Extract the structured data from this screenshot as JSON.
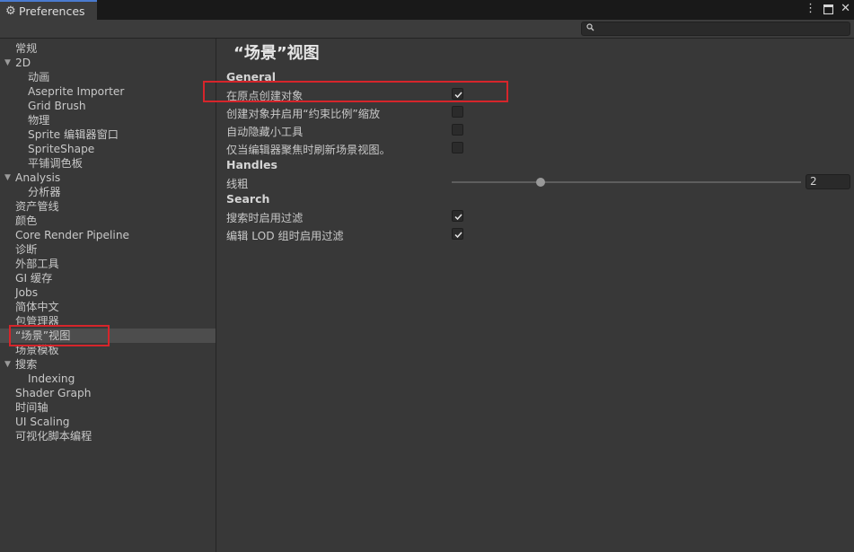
{
  "window": {
    "tab_title": "Preferences",
    "tab_icon": "gear-icon",
    "controls": [
      "more-icon",
      "maximize-icon",
      "close-icon"
    ]
  },
  "search": {
    "value": "",
    "placeholder": ""
  },
  "sidebar": {
    "items": [
      {
        "label": "常规"
      },
      {
        "label": "2D"
      },
      {
        "label": "动画"
      },
      {
        "label": "Aseprite Importer"
      },
      {
        "label": "Grid Brush"
      },
      {
        "label": "物理"
      },
      {
        "label": "Sprite 编辑器窗口"
      },
      {
        "label": "SpriteShape"
      },
      {
        "label": "平铺调色板"
      },
      {
        "label": "Analysis"
      },
      {
        "label": "分析器"
      },
      {
        "label": "资产管线"
      },
      {
        "label": "颜色"
      },
      {
        "label": "Core Render Pipeline"
      },
      {
        "label": "诊断"
      },
      {
        "label": "外部工具"
      },
      {
        "label": "GI 缓存"
      },
      {
        "label": "Jobs"
      },
      {
        "label": "简体中文"
      },
      {
        "label": "包管理器"
      },
      {
        "label": "“场景”视图"
      },
      {
        "label": "场景模板"
      },
      {
        "label": "搜索"
      },
      {
        "label": "Indexing"
      },
      {
        "label": "Shader Graph"
      },
      {
        "label": "时间轴"
      },
      {
        "label": "UI Scaling"
      },
      {
        "label": "可视化脚本编程"
      }
    ],
    "selected": "“场景”视图"
  },
  "main": {
    "title": "“场景”视图",
    "general": {
      "header": "General",
      "rows": [
        {
          "label": "在原点创建对象",
          "checked": true
        },
        {
          "label": "创建对象并启用“约束比例”缩放",
          "checked": false
        },
        {
          "label": "自动隐藏小工具",
          "checked": false
        },
        {
          "label": "仅当编辑器聚焦时刷新场景视图。",
          "checked": false
        }
      ]
    },
    "handles": {
      "header": "Handles",
      "line_thickness_label": "线粗",
      "line_thickness_value": "2"
    },
    "search": {
      "header": "Search",
      "rows": [
        {
          "label": "搜索时启用过滤",
          "checked": true
        },
        {
          "label": "编辑 LOD 组时启用过滤",
          "checked": true
        }
      ]
    }
  },
  "colors": {
    "highlight": "#d6252b",
    "selection": "#4d4d4d",
    "accent": "#4a7bd0"
  }
}
